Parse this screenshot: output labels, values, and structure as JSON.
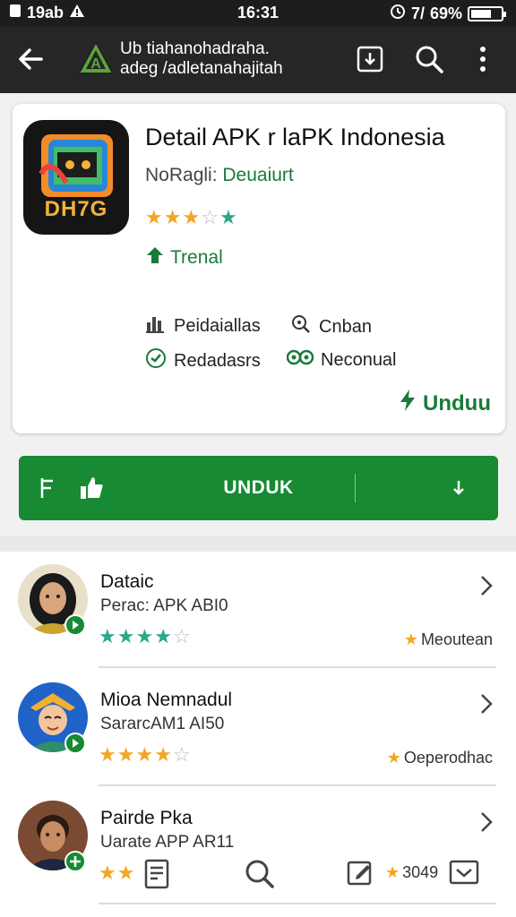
{
  "status_bar": {
    "left_text": "19ab",
    "time": "16:31",
    "battery_text": "69%",
    "signal_text": "7/"
  },
  "header": {
    "title_line1": "Ub tiahanohadraha.",
    "title_line2": "adeg /adletanahajitah"
  },
  "app": {
    "title": "Detail APK r laPK Indonesia",
    "developer_prefix": "NoRagli: ",
    "developer_name": "Deuaiurt",
    "rating": 3.5,
    "trend_label": "Trenal",
    "meta": {
      "category": "Peidaiallas",
      "search": "Cnban",
      "reviews": "Redadasrs",
      "language": "Neconual"
    },
    "download_link": "Unduu",
    "icon_tag": "DH7G"
  },
  "download_button": {
    "label": "UNDUK"
  },
  "list_items": [
    {
      "name": "Dataic",
      "subtitle": "Perac: APK ABI0",
      "rating": 4,
      "tagline": "Meoutean"
    },
    {
      "name": "Mioa Nemnadul",
      "subtitle": "SararcAM1 AI50",
      "rating": 4,
      "tagline": "Oeperodhac"
    },
    {
      "name": "Pairde Pka",
      "subtitle": "Uarate APP AR11",
      "rating": 2,
      "tagline": ""
    }
  ],
  "bottom_nav": {
    "count": "3049"
  },
  "colors": {
    "brand_green": "#178a33",
    "accent_green": "#1a7a39",
    "star": "#f2a623",
    "header": "#262626"
  }
}
